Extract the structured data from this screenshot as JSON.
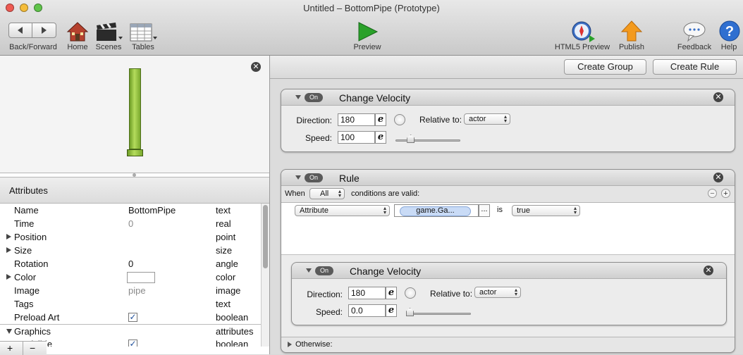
{
  "window": {
    "title": "Untitled – BottomPipe (Prototype)"
  },
  "toolbar": {
    "back_forward": "Back/Forward",
    "home": "Home",
    "scenes": "Scenes",
    "tables": "Tables",
    "preview": "Preview",
    "html5_preview": "HTML5 Preview",
    "publish": "Publish",
    "feedback": "Feedback",
    "help": "Help"
  },
  "attributes": {
    "header": "Attributes",
    "rows": [
      {
        "name": "Name",
        "value": "BottomPipe",
        "type": "text"
      },
      {
        "name": "Time",
        "value": "0",
        "type": "real"
      },
      {
        "name": "Position",
        "value": "",
        "type": "point"
      },
      {
        "name": "Size",
        "value": "",
        "type": "size"
      },
      {
        "name": "Rotation",
        "value": "0",
        "type": "angle"
      },
      {
        "name": "Color",
        "value": "",
        "type": "color"
      },
      {
        "name": "Image",
        "value": "pipe",
        "type": "image"
      },
      {
        "name": "Tags",
        "value": "",
        "type": "text"
      },
      {
        "name": "Preload Art",
        "value": "",
        "type": "boolean"
      },
      {
        "name": "Graphics",
        "value": "",
        "type": "attributes"
      },
      {
        "name": "Visible",
        "value": "",
        "type": "boolean"
      }
    ],
    "add": "+",
    "remove": "−"
  },
  "actions": {
    "create_group": "Create Group",
    "create_rule": "Create Rule"
  },
  "behavior1": {
    "on": "On",
    "title": "Change Velocity",
    "direction_label": "Direction:",
    "direction_value": "180",
    "relative_label": "Relative to:",
    "relative_value": "actor",
    "speed_label": "Speed:",
    "speed_value": "100",
    "speed_level": 0.2
  },
  "rule": {
    "on": "On",
    "title": "Rule",
    "when": "When",
    "when_value": "All",
    "conditions_text": "conditions are valid:",
    "condition_type": "Attribute",
    "condition_attr": "game.Ga...",
    "ellipsis": "...",
    "is": "is",
    "condition_value": "true",
    "otherwise": "Otherwise:"
  },
  "behavior2": {
    "on": "On",
    "title": "Change Velocity",
    "direction_label": "Direction:",
    "direction_value": "180",
    "relative_label": "Relative to:",
    "relative_value": "actor",
    "speed_label": "Speed:",
    "speed_value": "0.0",
    "speed_level": 0
  },
  "e_symbol": "e",
  "colors": {
    "pipe": "#8fc03a",
    "pill": "#5a5a5a",
    "publish": "#f39a1e",
    "preview": "#2aa12a"
  }
}
